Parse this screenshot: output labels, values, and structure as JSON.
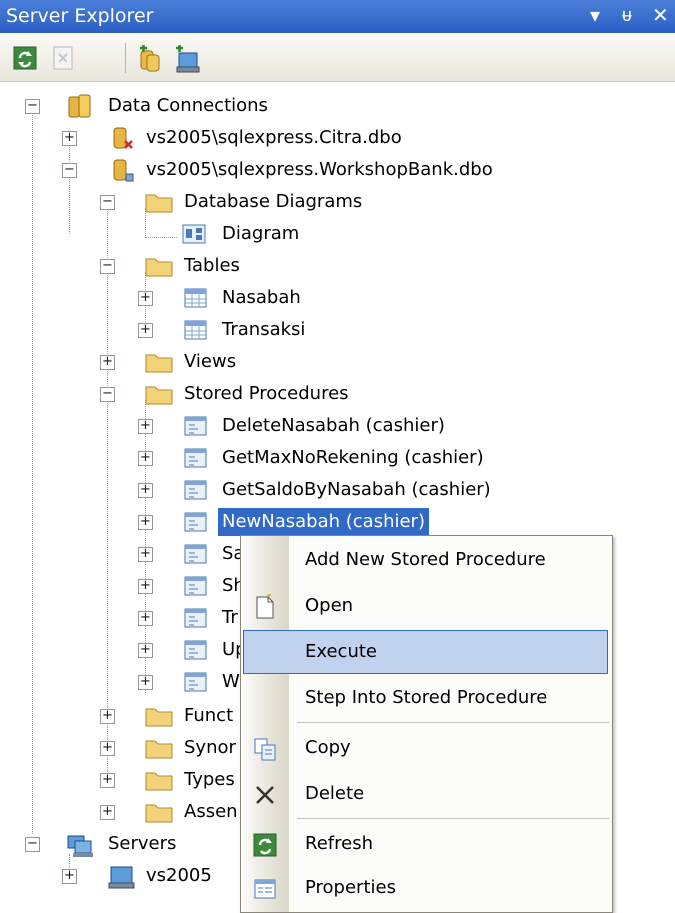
{
  "window": {
    "title": "Server Explorer",
    "dropdown_icon": "▾",
    "pin_icon": "ᵾ",
    "close_icon": "✕"
  },
  "toolbar": {
    "buttons": [
      {
        "name": "refresh-button",
        "icon": "refresh-icon"
      },
      {
        "name": "stop-refresh-button",
        "icon": "stop-icon"
      },
      {
        "name": "connect-to-database-button",
        "icon": "connect-database-icon"
      },
      {
        "name": "connect-to-server-button",
        "icon": "connect-server-icon"
      }
    ]
  },
  "tree": {
    "data_connections": "Data Connections",
    "conn_citra": "vs2005\\sqlexpress.Citra.dbo",
    "conn_workshop": "vs2005\\sqlexpress.WorkshopBank.dbo",
    "database_diagrams": "Database Diagrams",
    "diagram": "Diagram",
    "tables": "Tables",
    "table_nasabah": "Nasabah",
    "table_transaksi": "Transaksi",
    "views": "Views",
    "stored_procedures": "Stored Procedures",
    "procs": [
      "DeleteNasabah (cashier)",
      "GetMaxNoRekening (cashier)",
      "GetSaldoByNasabah (cashier)",
      "NewNasabah (cashier)",
      "Sa",
      "Sh",
      "Tr",
      "Up",
      "W"
    ],
    "functions": "Funct",
    "synonyms": "Synor",
    "types": "Types",
    "assemblies": "Assen",
    "servers": "Servers",
    "server_vs2005": "vs2005"
  },
  "context_menu": {
    "items": [
      {
        "label": "Add New Stored Procedure",
        "icon": ""
      },
      {
        "label": "Open",
        "icon": "open-icon"
      },
      {
        "label": "Execute",
        "icon": "",
        "highlighted": true
      },
      {
        "label": "Step Into Stored Procedure",
        "icon": ""
      },
      {
        "label": "Copy",
        "icon": "copy-icon"
      },
      {
        "label": "Delete",
        "icon": "delete-icon"
      },
      {
        "label": "Refresh",
        "icon": "refresh-icon"
      },
      {
        "label": "Properties",
        "icon": "properties-icon"
      }
    ]
  },
  "colors": {
    "title_bar": "#2b5fc4",
    "selection": "#3169c6",
    "menu_highlight": "#c1d2ee"
  }
}
